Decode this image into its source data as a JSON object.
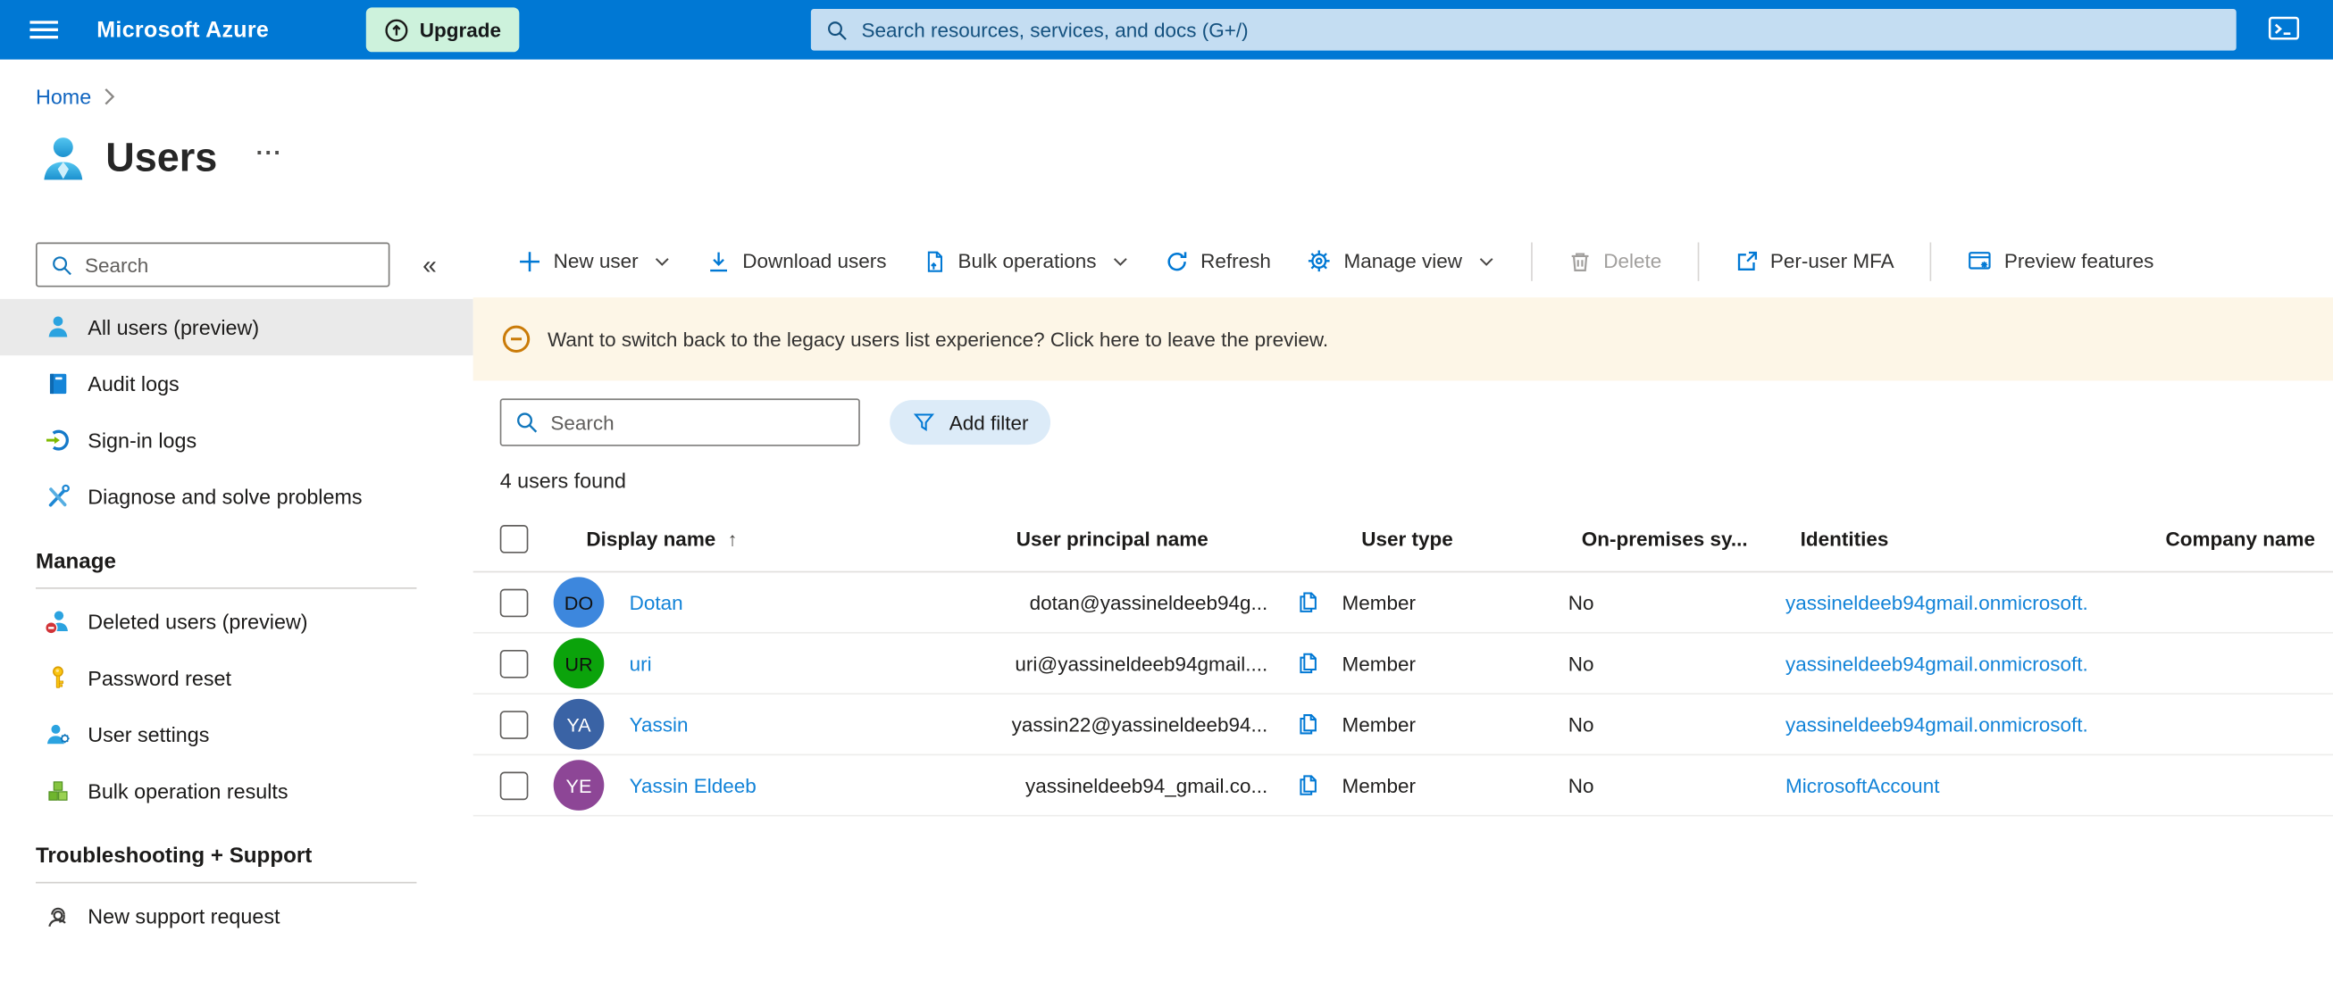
{
  "colors": {
    "topbar_bg": "#0078d4",
    "accent": "#0078d4",
    "upgrade_bg": "#cdf2dc",
    "topbar_search_bg": "#c4ddf2",
    "banner_bg": "#fdf6e7",
    "banner_icon": "#ca7b08",
    "selected_item_bg": "#eaeaea",
    "link": "#1283d8",
    "breadcrumb_link": "#1065c0",
    "disabled_text": "#a19f9d"
  },
  "topbar": {
    "brand": "Microsoft Azure",
    "upgrade_label": "Upgrade",
    "search_placeholder": "Search resources, services, and docs (G+/)"
  },
  "breadcrumb": {
    "home": "Home"
  },
  "page": {
    "title": "Users",
    "more_label": "..."
  },
  "sidebar": {
    "search_placeholder": "Search",
    "collapse_glyph": "«",
    "items": [
      {
        "label": "All users (preview)",
        "icon": "user-icon",
        "selected": true
      },
      {
        "label": "Audit logs",
        "icon": "book-icon",
        "selected": false
      },
      {
        "label": "Sign-in logs",
        "icon": "sign-in-icon",
        "selected": false
      },
      {
        "label": "Diagnose and solve problems",
        "icon": "tools-icon",
        "selected": false
      }
    ],
    "sections": [
      {
        "heading": "Manage",
        "items": [
          {
            "label": "Deleted users (preview)",
            "icon": "user-deleted-icon"
          },
          {
            "label": "Password reset",
            "icon": "key-icon"
          },
          {
            "label": "User settings",
            "icon": "user-gear-icon"
          },
          {
            "label": "Bulk operation results",
            "icon": "cubes-icon"
          }
        ]
      },
      {
        "heading": "Troubleshooting + Support",
        "items": [
          {
            "label": "New support request",
            "icon": "headset-icon"
          }
        ]
      }
    ]
  },
  "toolbar": {
    "new_user": "New user",
    "download_users": "Download users",
    "bulk_operations": "Bulk operations",
    "refresh": "Refresh",
    "manage_view": "Manage view",
    "delete": "Delete",
    "per_user_mfa": "Per-user MFA",
    "preview_features": "Preview features"
  },
  "banner": {
    "message": "Want to switch back to the legacy users list experience? Click here to leave the preview."
  },
  "filters": {
    "search_placeholder": "Search",
    "add_filter": "Add filter"
  },
  "results_count": "4 users found",
  "table": {
    "sort_glyph": "↑",
    "columns": [
      "Display name",
      "User principal name",
      "User type",
      "On-premises sy...",
      "Identities",
      "Company name"
    ],
    "rows": [
      {
        "initials": "DO",
        "avatar_bg": "#3d87dd",
        "avatar_fg": "#111111",
        "display_name": "Dotan",
        "upn": "dotan@yassineldeeb94g...",
        "user_type": "Member",
        "on_premises": "No",
        "identities": "yassineldeeb94gmail.onmicrosoft.",
        "company": ""
      },
      {
        "initials": "UR",
        "avatar_bg": "#0ba30b",
        "avatar_fg": "#111111",
        "display_name": "uri",
        "upn": "uri@yassineldeeb94gmail....",
        "user_type": "Member",
        "on_premises": "No",
        "identities": "yassineldeeb94gmail.onmicrosoft.",
        "company": ""
      },
      {
        "initials": "YA",
        "avatar_bg": "#3a63a5",
        "avatar_fg": "#ffffff",
        "display_name": "Yassin",
        "upn": "yassin22@yassineldeeb94...",
        "user_type": "Member",
        "on_premises": "No",
        "identities": "yassineldeeb94gmail.onmicrosoft.",
        "company": ""
      },
      {
        "initials": "YE",
        "avatar_bg": "#8d4696",
        "avatar_fg": "#ffffff",
        "display_name": "Yassin Eldeeb",
        "upn": "yassineldeeb94_gmail.co...",
        "user_type": "Member",
        "on_premises": "No",
        "identities": "MicrosoftAccount",
        "company": ""
      }
    ]
  }
}
